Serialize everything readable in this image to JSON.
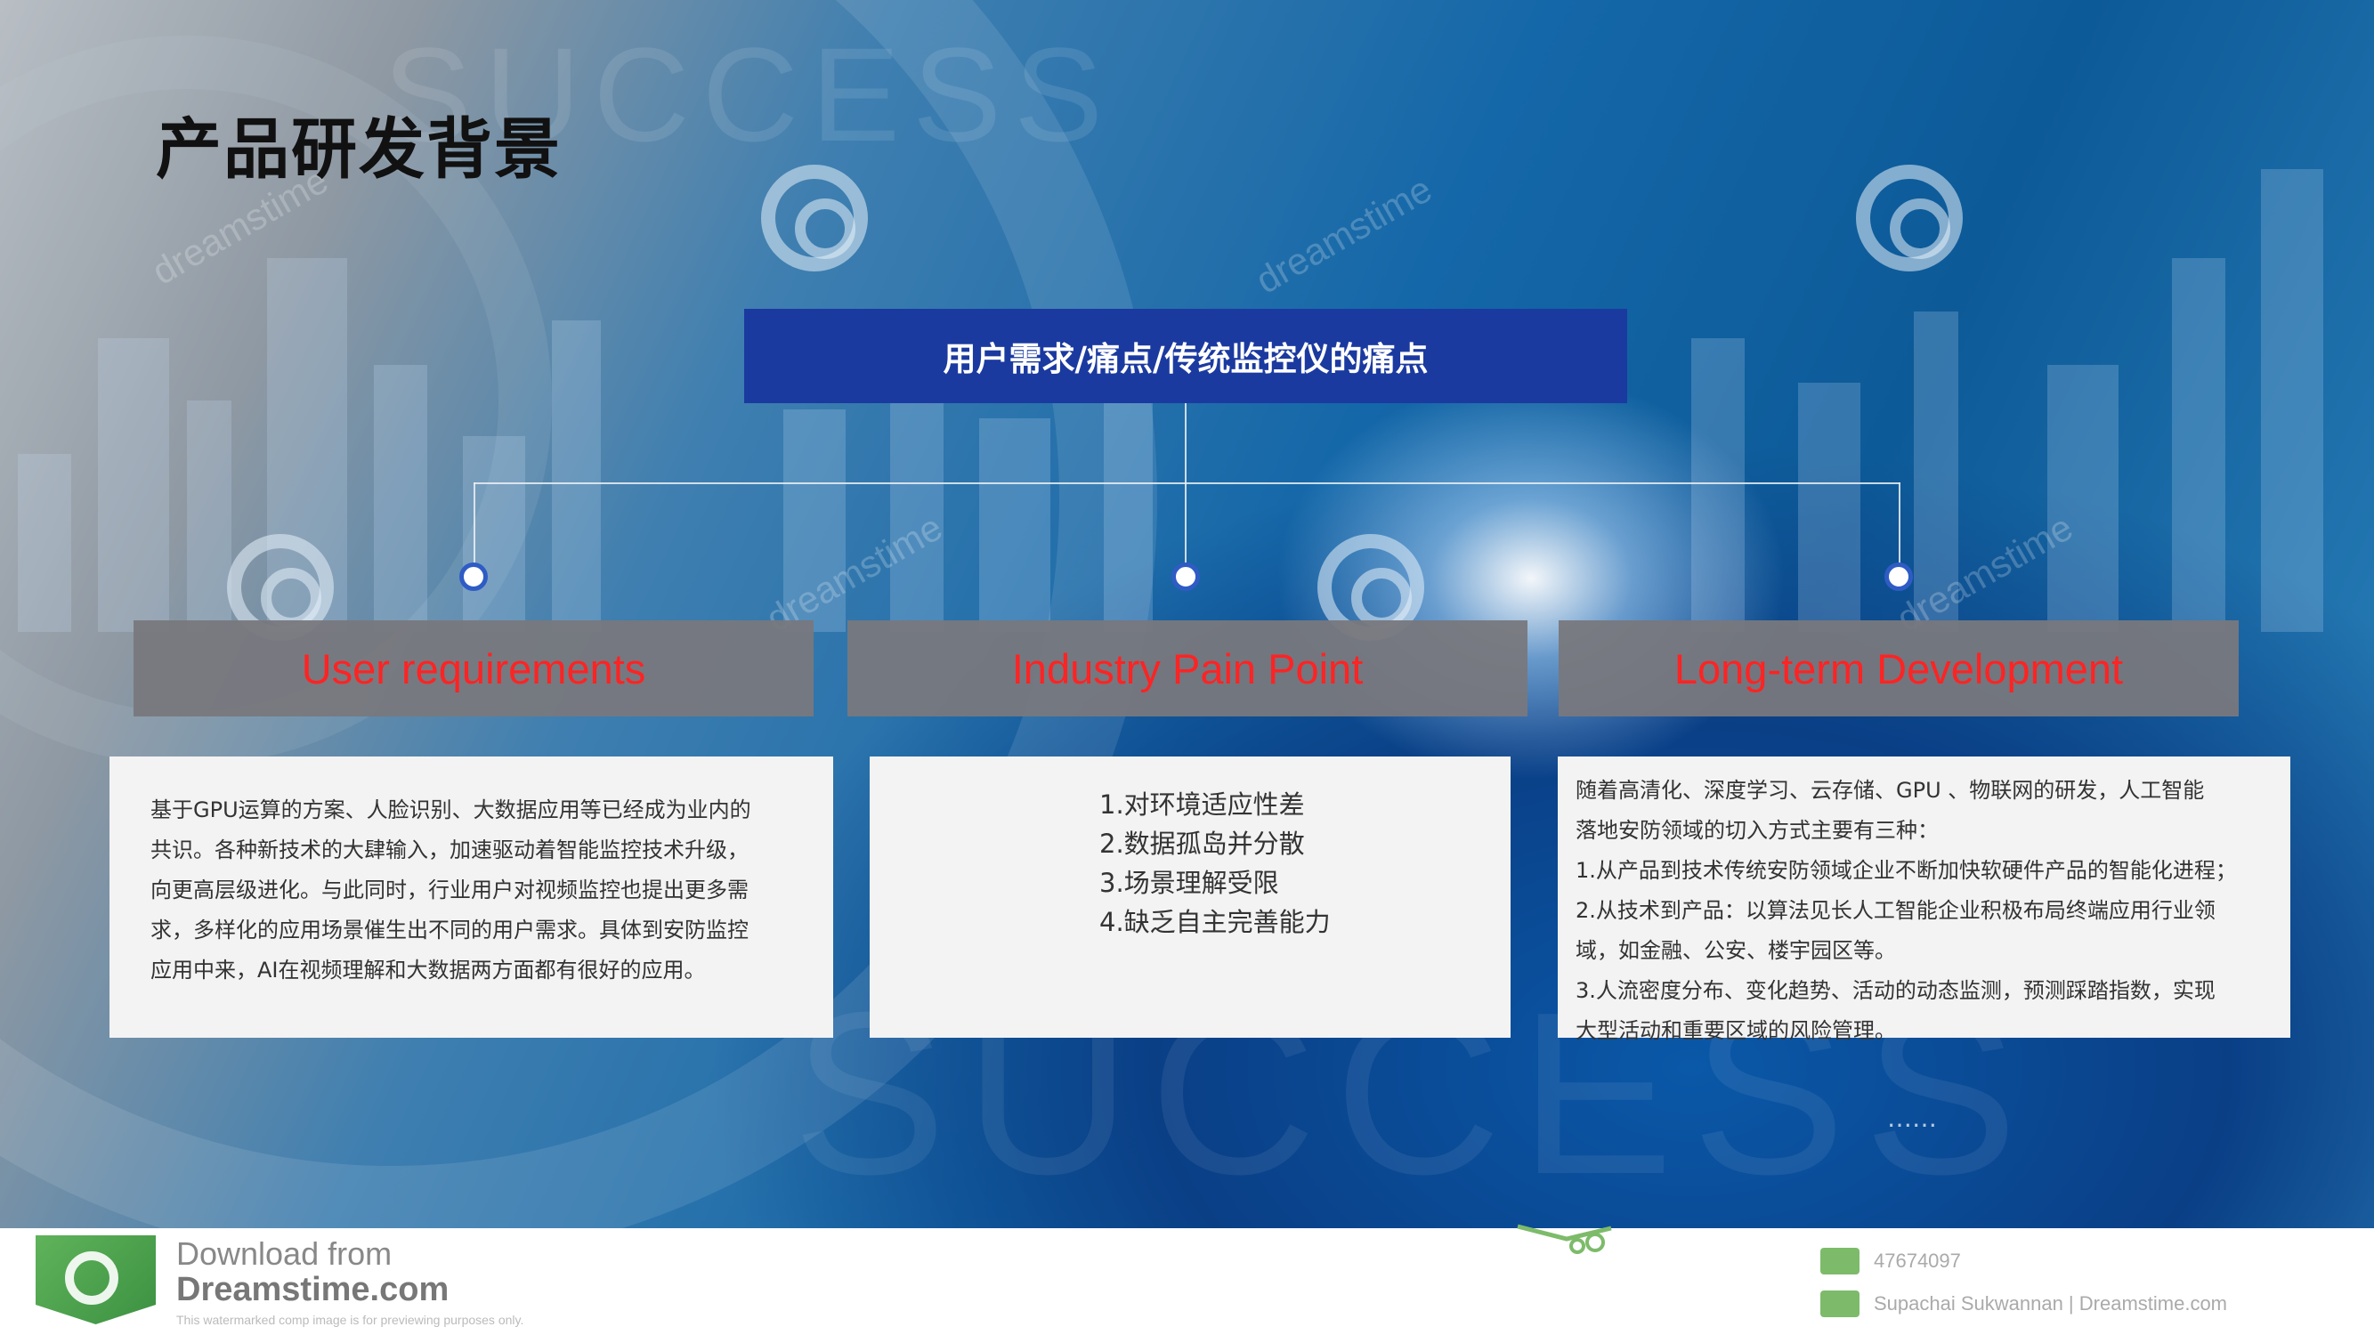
{
  "slide": {
    "title": "产品研发背景",
    "banner": "用户需求/痛点/传统监控仪的痛点"
  },
  "categories": [
    {
      "label": "User requirements"
    },
    {
      "label": "Industry Pain Point"
    },
    {
      "label": "Long-term Development"
    }
  ],
  "cards": {
    "user_lines": [
      "基于GPU运算的方案、人脸识别、大数据应用等已经成为业内的",
      "共识。各种新技术的大肆输入，加速驱动着智能监控技术升级，",
      "向更高层级进化。与此同时，行业用户对视频监控也提出更多需",
      "求，多样化的应用场景催生出不同的用户需求。具体到安防监控",
      "应用中来，AI在视频理解和大数据两方面都有很好的应用。"
    ],
    "pain_lines": [
      "1.对环境适应性差",
      "2.数据孤岛并分散",
      "3.场景理解受限",
      "4.缺乏自主完善能力"
    ],
    "long_lines": [
      "随着高清化、深度学习、云存储、GPU 、物联网的研发，人工智能",
      "落地安防领域的切入方式主要有三种：",
      "1.从产品到技术传统安防领域企业不断加快软硬件产品的智能化进程；",
      "2.从技术到产品：以算法见长人工智能企业积极布局终端应用行业领",
      "域，如金融、公安、楼宇园区等。",
      "3.人流密度分布、变化趋势、活动的动态监测，预测踩踏指数，实现",
      "大型活动和重要区域的风险管理。"
    ],
    "ellipsis": "……"
  },
  "background": {
    "watermark_word": "SUCCESS",
    "watermark_brand": "dreamstime"
  },
  "footer": {
    "download_line1": "Download from",
    "download_line2": "Dreamstime.com",
    "download_line3": "This watermarked comp image is for previewing purposes only.",
    "image_id": "47674097",
    "credit": "Supachai Sukwannan | Dreamstime.com"
  },
  "colors": {
    "banner": "#1b3aa0",
    "category_bg": "#78787d",
    "category_text": "#ff2323",
    "card_bg": "#f3f3f3",
    "title": "#111111"
  }
}
